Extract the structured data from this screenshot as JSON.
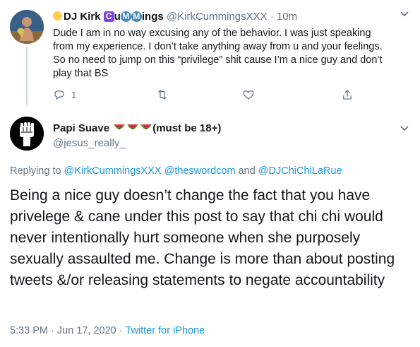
{
  "tweet1": {
    "display_name_prefix": "DJ Kirk ",
    "badge_c": "C",
    "name_u": "u",
    "badge_m1": "M",
    "badge_m2": "M",
    "name_suffix": "ings",
    "handle": "@KirkCummingsXXX",
    "separator": "·",
    "time": "10m",
    "text": "Dude I am in no way excusing any of the behavior. I was just speaking from my experience. I don’t take anything away from u and your feelings. So no need to jump on this “privilege” shit cause I’m a nice guy and don’t play that BS",
    "reply_count": "1",
    "icons": [
      "reply-icon",
      "retweet-icon",
      "like-icon",
      "share-icon"
    ]
  },
  "tweet2": {
    "display_name": "Papi Suave",
    "name_tail": "(must be 18+)",
    "handle": "@jesus_really_",
    "replying_to_label": "Replying to",
    "mention1": "@KirkCummingsXXX",
    "mention2": "@theswordcom",
    "and_label": "and",
    "mention3": "@DJChiChiLaRue",
    "text": "Being a nice guy doesn’t change the fact that you have privelege & cane under this post to say that chi chi would never intentionally hurt someone when she purposely sexually assaulted me. Change is more than about posting tweets &/or releasing statements to negate accountability",
    "timestamp": "5:33 PM · Jun 17, 2020",
    "separator": "·",
    "source": "Twitter for iPhone"
  },
  "colors": {
    "link": "#1b95e0",
    "secondary_text": "#657786",
    "primary_text": "#14171a",
    "thread_line": "#ccd6dd"
  }
}
